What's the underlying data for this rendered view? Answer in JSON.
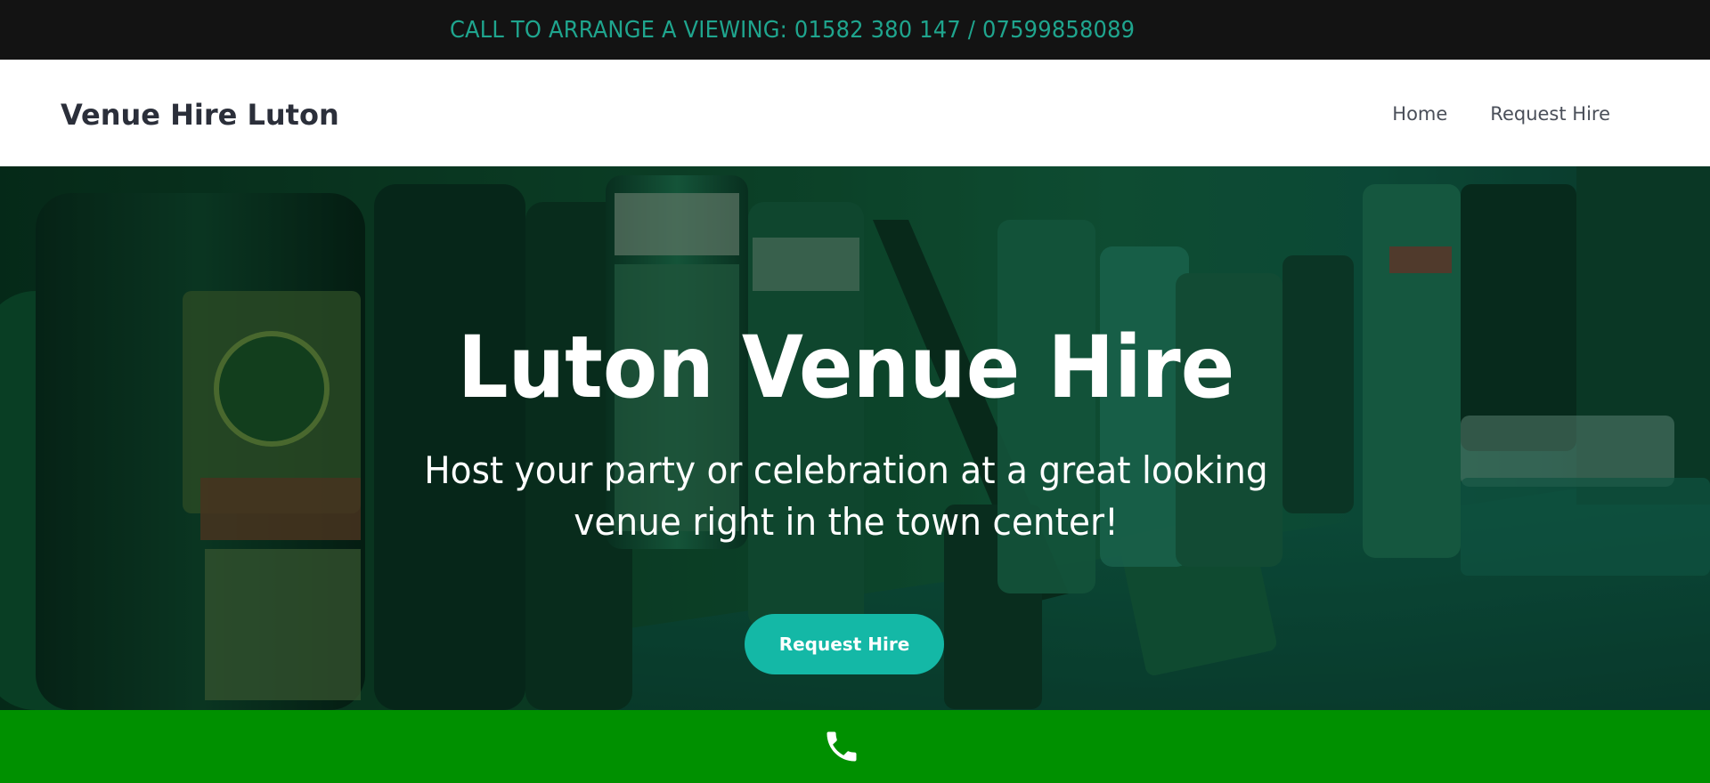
{
  "topbar": {
    "text": "CALL TO ARRANGE A VIEWING: 01582 380 147 / 07599858089"
  },
  "navbar": {
    "brand": "Venue Hire Luton",
    "links": [
      {
        "label": "Home"
      },
      {
        "label": "Request Hire"
      }
    ]
  },
  "hero": {
    "title": "Luton Venue Hire",
    "subtitle": "Host your party or celebration at a great looking venue right in the town center!",
    "cta_label": "Request Hire",
    "background": "bar-shelf-bottles-image"
  },
  "callbar": {
    "icon": "phone-icon",
    "color": "#009000"
  },
  "colors": {
    "topbar_bg": "#131313",
    "topbar_text": "#1fa58e",
    "cta": "#14b8a6",
    "callbar": "#009000"
  }
}
